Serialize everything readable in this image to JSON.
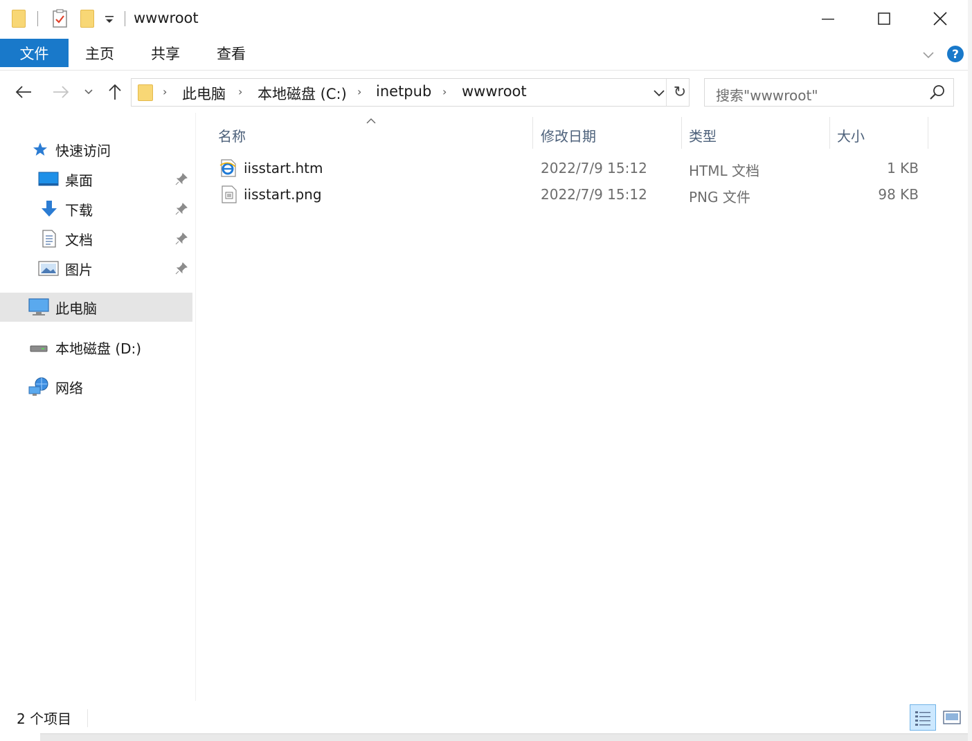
{
  "window": {
    "title": "wwwroot"
  },
  "ribbon": {
    "file_tab": "文件",
    "tabs": [
      "主页",
      "共享",
      "查看"
    ]
  },
  "address": {
    "breadcrumbs": [
      "此电脑",
      "本地磁盘 (C:)",
      "inetpub",
      "wwwroot"
    ],
    "search_placeholder": "搜索\"wwwroot\""
  },
  "nav": {
    "quick_access": "快速访问",
    "pinned": [
      {
        "label": "桌面",
        "icon": "desktop-icon"
      },
      {
        "label": "下载",
        "icon": "download-icon"
      },
      {
        "label": "文档",
        "icon": "documents-icon"
      },
      {
        "label": "图片",
        "icon": "pictures-icon"
      }
    ],
    "this_pc": "此电脑",
    "local_disk_d": "本地磁盘 (D:)",
    "network": "网络"
  },
  "columns": {
    "name": "名称",
    "date": "修改日期",
    "type": "类型",
    "size": "大小"
  },
  "files": [
    {
      "name": "iisstart.htm",
      "date": "2022/7/9 15:12",
      "type": "HTML 文档",
      "size": "1 KB",
      "icon": "html-file-icon"
    },
    {
      "name": "iisstart.png",
      "date": "2022/7/9 15:12",
      "type": "PNG 文件",
      "size": "98 KB",
      "icon": "image-file-icon"
    }
  ],
  "status": {
    "item_count": "2 个项目"
  },
  "colors": {
    "accent": "#1979ca",
    "selection": "#e5e5e5",
    "header_text": "#4c607a",
    "folder": "#f8d775"
  }
}
